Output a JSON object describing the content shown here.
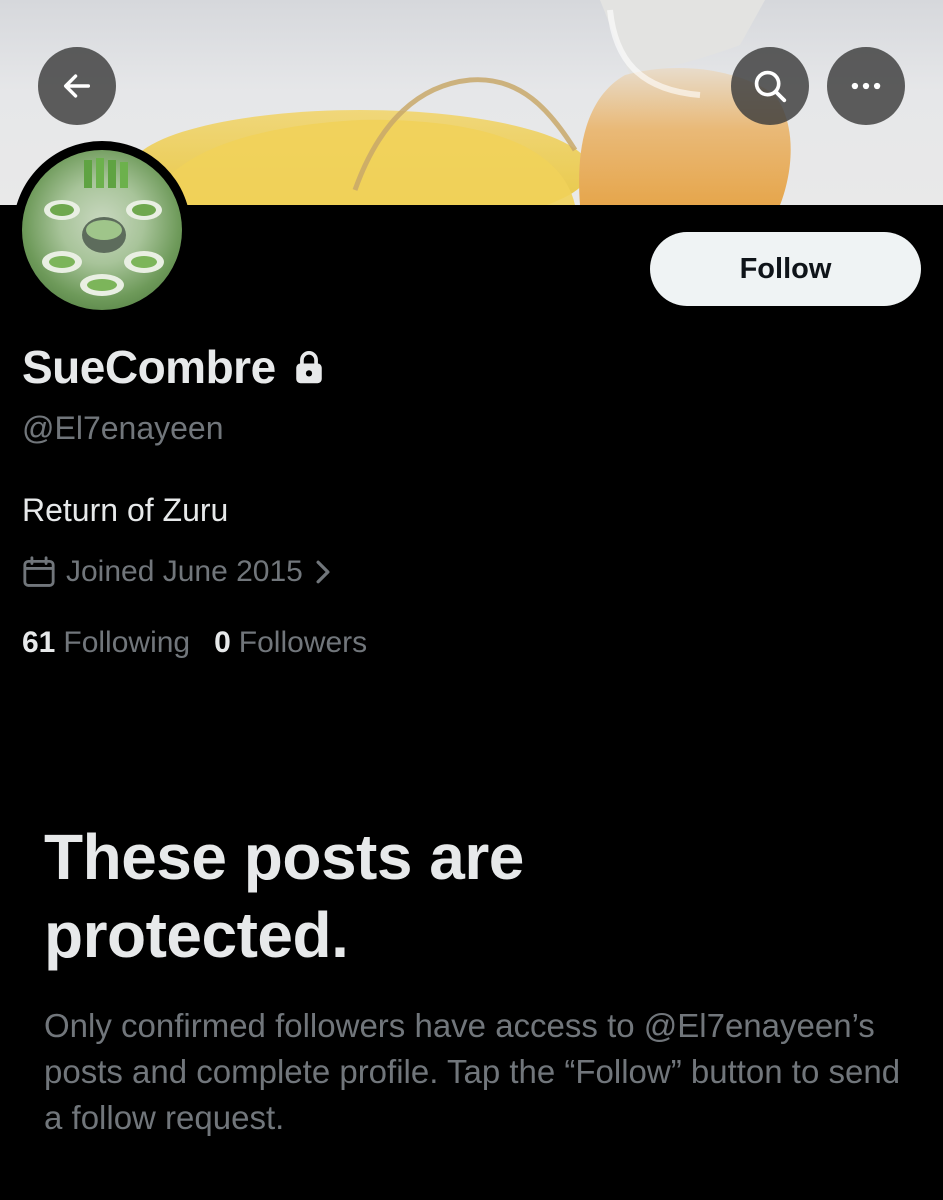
{
  "header": {
    "back_icon": "arrow-left-icon",
    "search_icon": "search-icon",
    "more_icon": "more-horizontal-icon"
  },
  "profile": {
    "display_name": "SueCombre",
    "protected_icon": "lock-icon",
    "handle": "@El7enayeen",
    "bio": "Return of Zuru",
    "joined": "Joined June 2015",
    "following_count": "61",
    "following_label": "Following",
    "followers_count": "0",
    "followers_label": "Followers"
  },
  "actions": {
    "follow_label": "Follow"
  },
  "protected_notice": {
    "title": "These posts are protected.",
    "description": "Only confirmed followers have access to @El7enayeen’s posts and complete profile. Tap the “Follow” button to send a follow request."
  },
  "colors": {
    "background": "#000000",
    "primary_text": "#e7e9ea",
    "secondary_text": "#71767b",
    "follow_button_bg": "#eff3f4"
  }
}
